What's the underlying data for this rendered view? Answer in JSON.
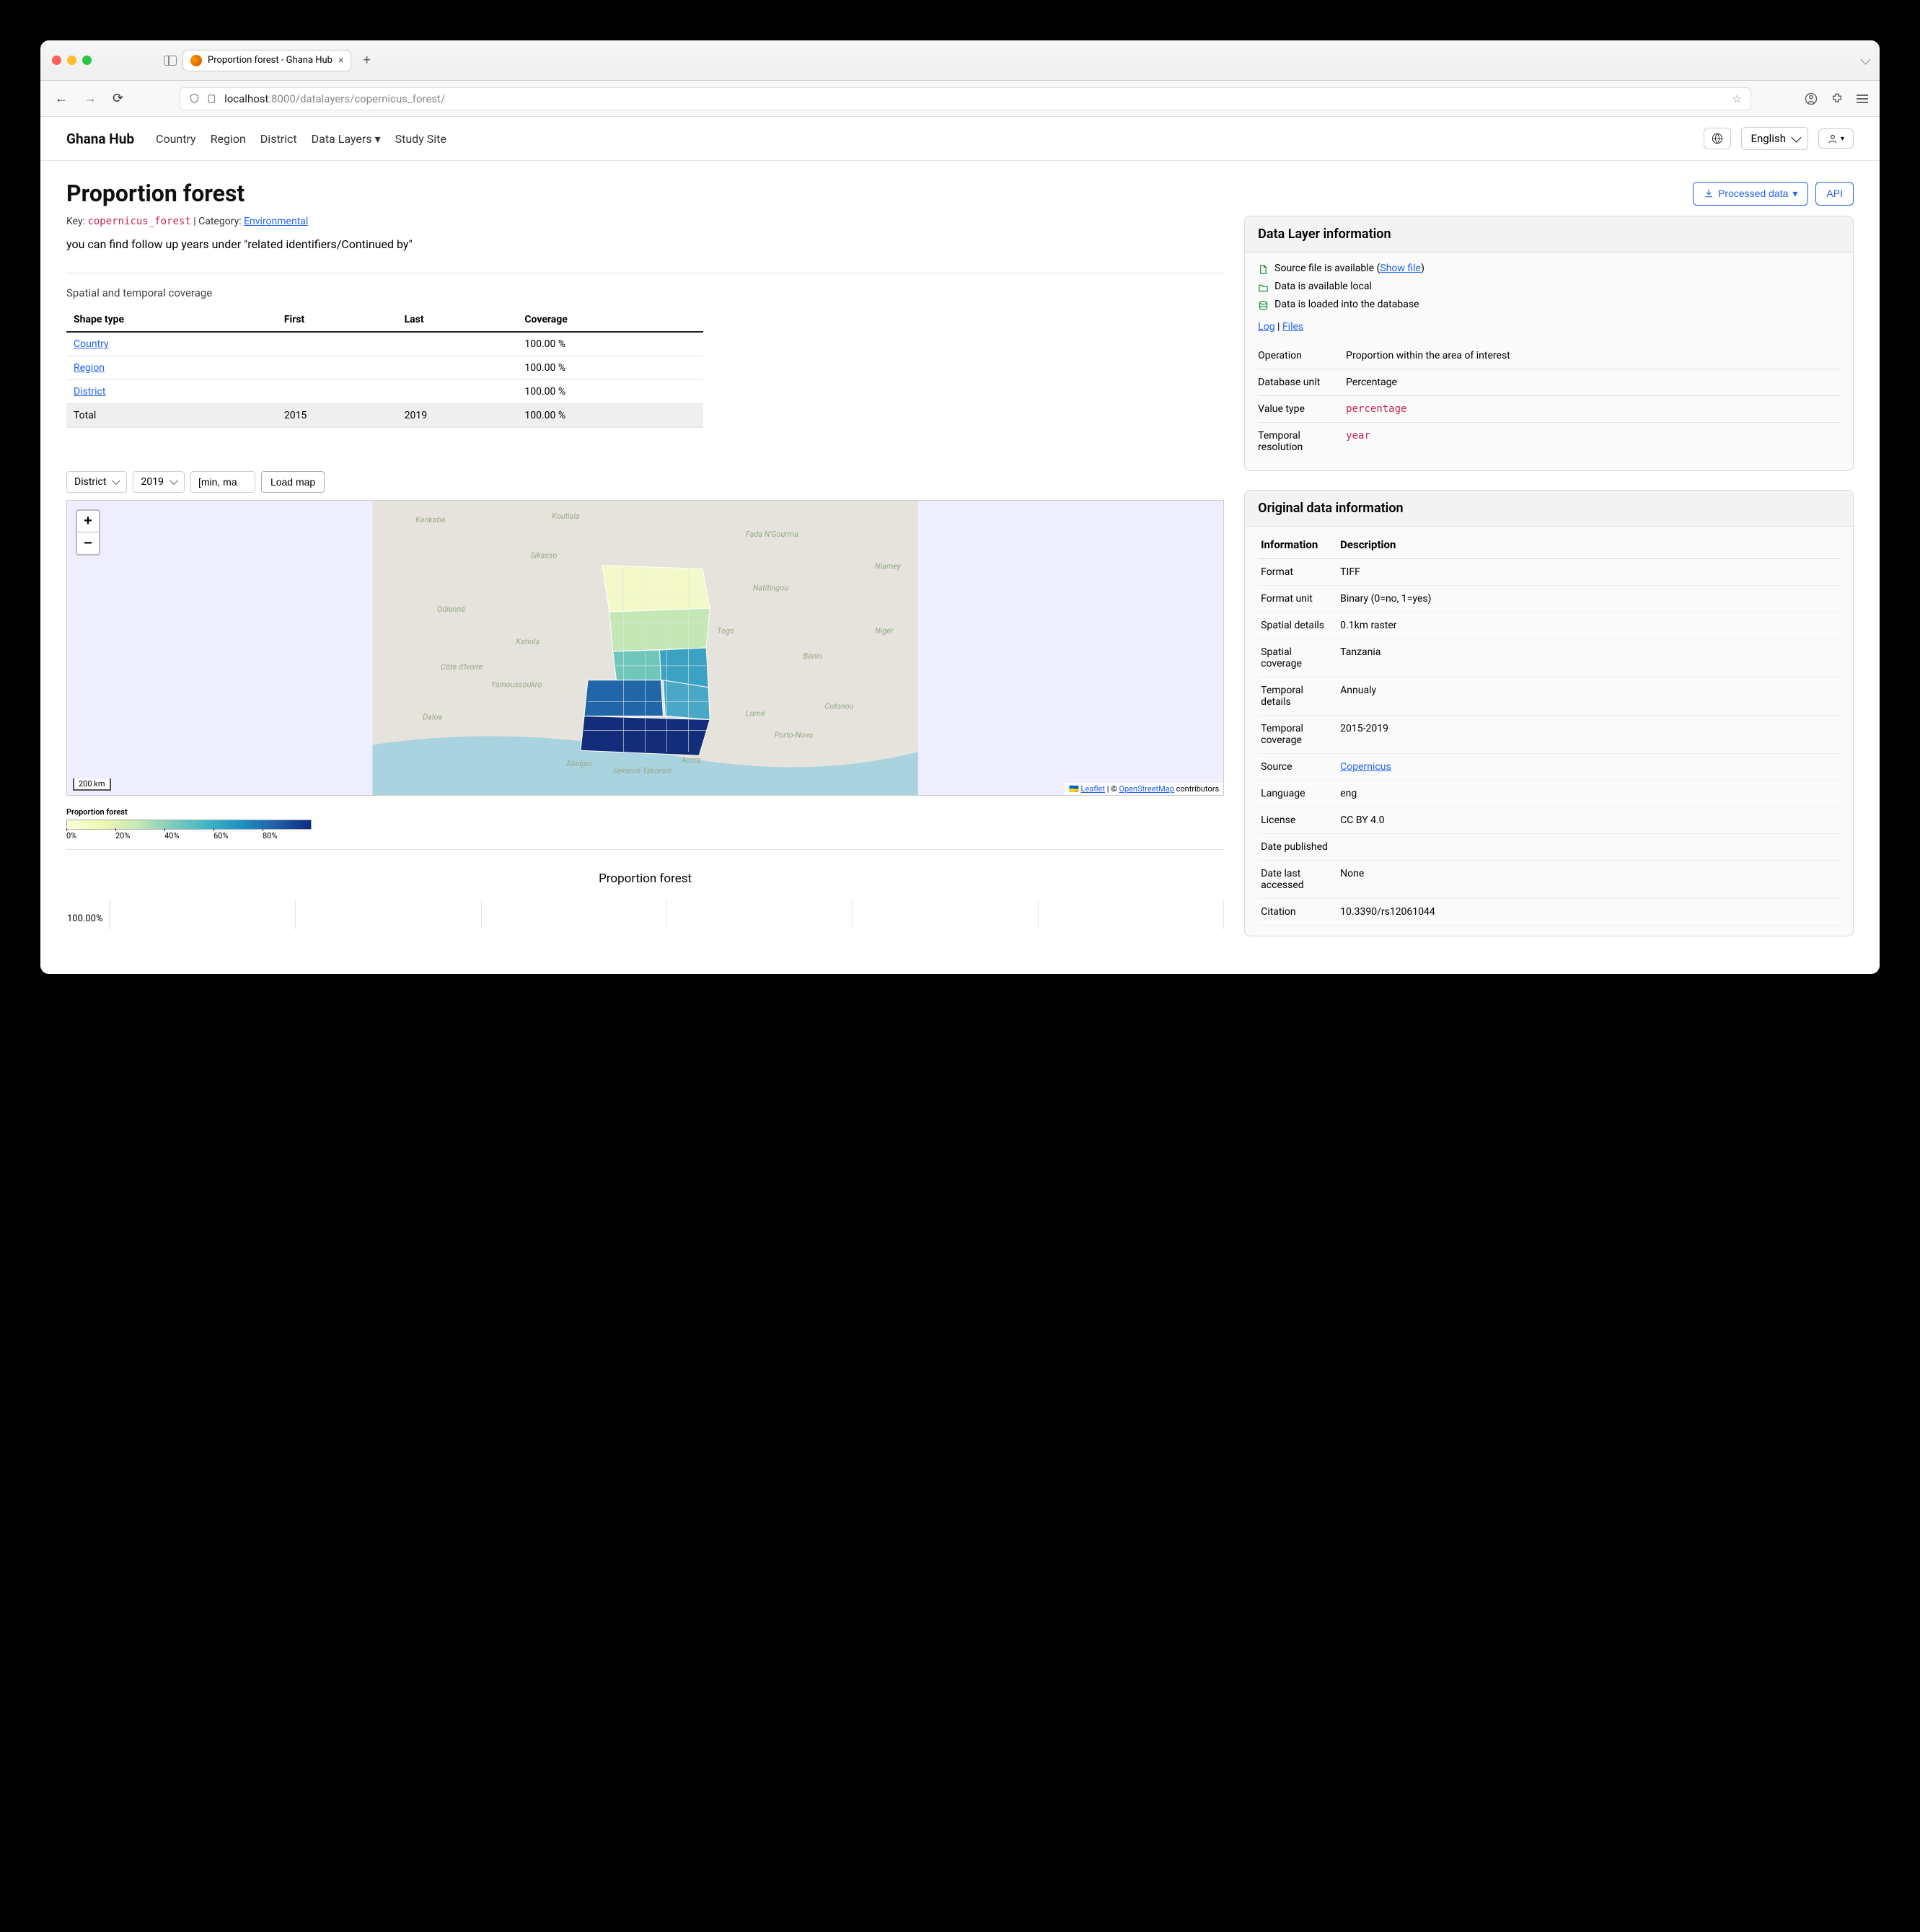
{
  "window": {
    "tab_title": "Proportion forest - Ghana Hub",
    "url_host": "localhost",
    "url_port": ":8000",
    "url_path": "/datalayers/copernicus_forest/"
  },
  "nav": {
    "brand": "Ghana Hub",
    "links": [
      "Country",
      "Region",
      "District",
      "Data Layers",
      "Study Site"
    ],
    "language": "English"
  },
  "header": {
    "title": "Proportion forest",
    "processed_btn": "Processed data",
    "api_btn": "API"
  },
  "meta": {
    "key_label": "Key:",
    "key_value": "copernicus_forest",
    "cat_label": "Category:",
    "cat_value": "Environmental",
    "description": "you can find follow up years under \"related identifiers/Continued by\"",
    "coverage_title": "Spatial and temporal coverage"
  },
  "coverage": {
    "headers": [
      "Shape type",
      "First",
      "Last",
      "Coverage"
    ],
    "rows": [
      {
        "shape": "Country",
        "first": "",
        "last": "",
        "cov": "100.00 %",
        "link": true
      },
      {
        "shape": "Region",
        "first": "",
        "last": "",
        "cov": "100.00 %",
        "link": true
      },
      {
        "shape": "District",
        "first": "",
        "last": "",
        "cov": "100.00 %",
        "link": true
      }
    ],
    "total": {
      "shape": "Total",
      "first": "2015",
      "last": "2019",
      "cov": "100.00 %"
    }
  },
  "map": {
    "level_select": "District",
    "year_select": "2019",
    "range_input": "[min, ma",
    "load_btn": "Load map",
    "zoom_in": "+",
    "zoom_out": "−",
    "scale": "200 km",
    "leaflet": "Leaflet",
    "osm": "OpenStreetMap",
    "osm_suffix": " contributors",
    "legend_title": "Proportion forest",
    "legend_ticks": [
      "0%",
      "20%",
      "40%",
      "60%",
      "80%"
    ]
  },
  "chart": {
    "title": "Proportion forest",
    "ylabel": "100.00%"
  },
  "datalayer": {
    "title": "Data Layer information",
    "source_text": "Source file is available (",
    "show_file": "Show file",
    "local_text": "Data is available local",
    "db_text": "Data is loaded into the database",
    "log": "Log",
    "files": "Files",
    "rows": [
      {
        "k": "Operation",
        "v": "Proportion within the area of interest"
      },
      {
        "k": "Database unit",
        "v": "Percentage"
      },
      {
        "k": "Value type",
        "v": "percentage",
        "code": true
      },
      {
        "k": "Temporal resolution",
        "v": "year",
        "code": true
      }
    ]
  },
  "original": {
    "title": "Original data information",
    "headers": [
      "Information",
      "Description"
    ],
    "rows": [
      {
        "k": "Format",
        "v": "TIFF"
      },
      {
        "k": "Format unit",
        "v": "Binary (0=no, 1=yes)"
      },
      {
        "k": "Spatial details",
        "v": "0.1km raster"
      },
      {
        "k": "Spatial coverage",
        "v": "Tanzania"
      },
      {
        "k": "Temporal details",
        "v": "Annualy"
      },
      {
        "k": "Temporal coverage",
        "v": "2015-2019"
      },
      {
        "k": "Source",
        "v": "Copernicus",
        "link": true
      },
      {
        "k": "Language",
        "v": "eng"
      },
      {
        "k": "License",
        "v": "CC BY 4.0"
      },
      {
        "k": "Date published",
        "v": ""
      },
      {
        "k": "Date last accessed",
        "v": "None"
      },
      {
        "k": "Citation",
        "v": "10.3390/rs12061044"
      }
    ]
  }
}
